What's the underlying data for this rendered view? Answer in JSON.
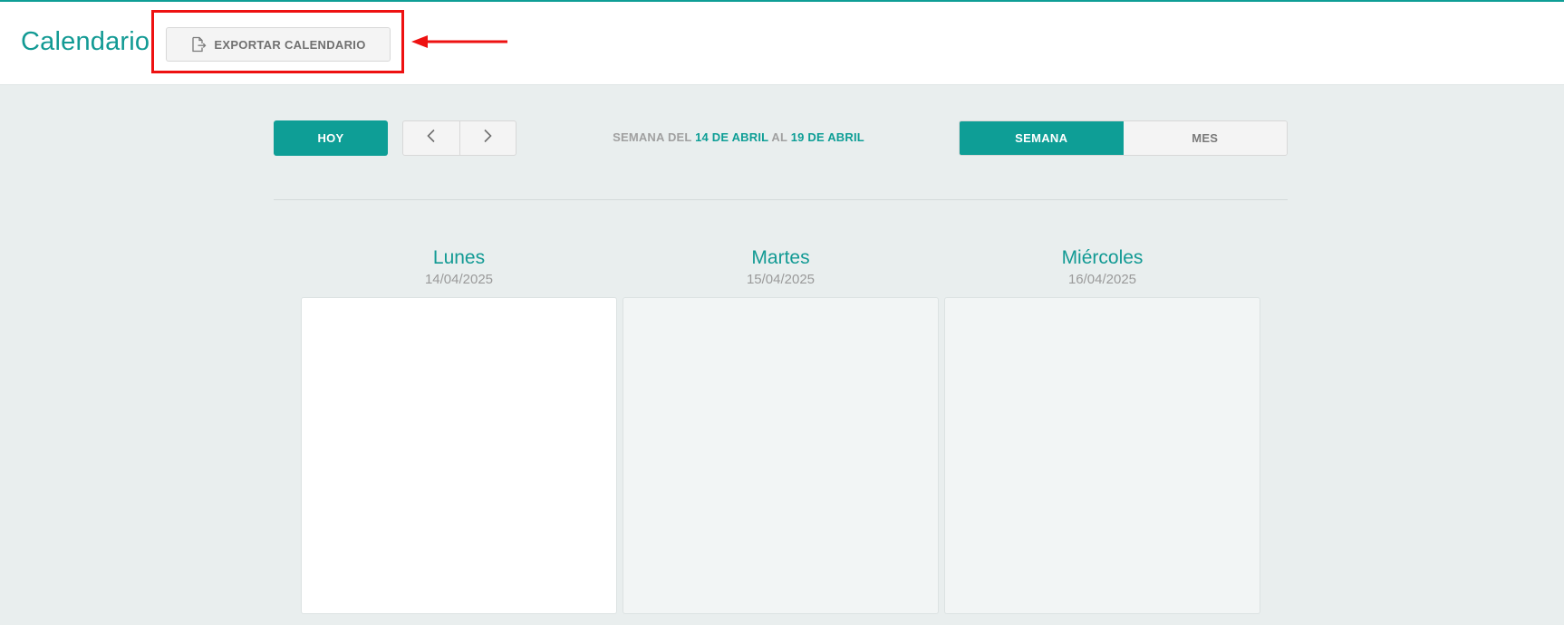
{
  "header": {
    "title": "Calendario",
    "export_label": "EXPORTAR CALENDARIO",
    "export_icon": "file-export-icon"
  },
  "annotation": {
    "highlight_color": "#ee1111",
    "arrow_color": "#ee1111"
  },
  "toolbar": {
    "today_label": "HOY",
    "prev_icon": "chevron-left-icon",
    "next_icon": "chevron-right-icon",
    "week_prefix": "SEMANA DEL",
    "week_start": "14 DE ABRIL",
    "week_mid": "AL",
    "week_end": "19 DE ABRIL",
    "views": [
      {
        "label": "SEMANA",
        "active": true
      },
      {
        "label": "MES",
        "active": false
      }
    ]
  },
  "days": [
    {
      "name": "Lunes",
      "date": "14/04/2025",
      "today": true
    },
    {
      "name": "Martes",
      "date": "15/04/2025",
      "today": false
    },
    {
      "name": "Miércoles",
      "date": "16/04/2025",
      "today": false
    }
  ],
  "colors": {
    "accent": "#0e9e96",
    "background": "#e9eeee",
    "header_bg": "#ffffff"
  }
}
